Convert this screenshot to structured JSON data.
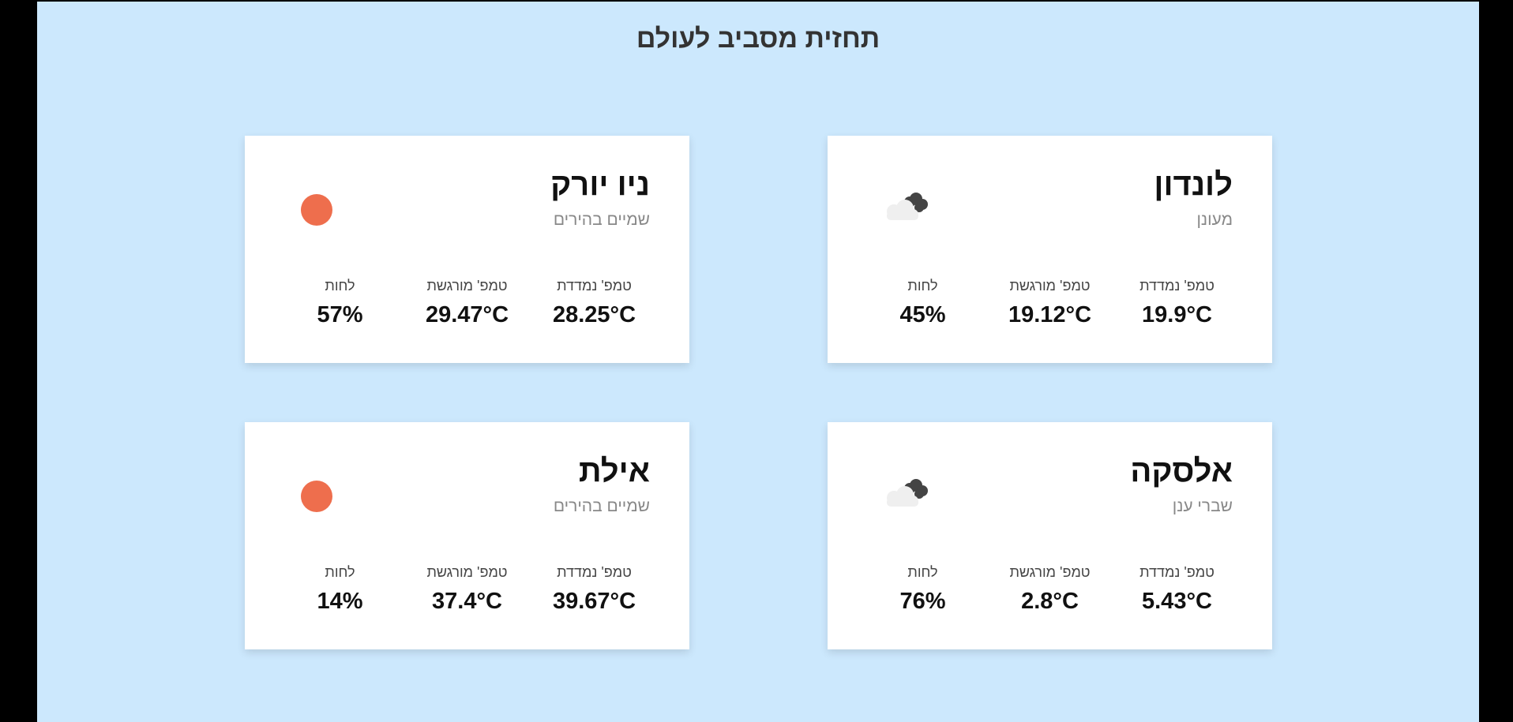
{
  "page": {
    "title": "תחזית מסביב לעולם"
  },
  "labels": {
    "temp": "טמפ' נמדדת",
    "feels_like": "טמפ' מורגשת",
    "humidity": "לחות"
  },
  "colors": {
    "background": "#cce8fd",
    "sun": "#ee6e4d",
    "cloud_dark": "#444444",
    "cloud_light": "#efefef"
  },
  "cards": [
    {
      "city": "לונדון",
      "description": "מעונן",
      "icon": "cloudy-icon",
      "temp": "19.9°C",
      "feels_like": "19.12°C",
      "humidity": "45%"
    },
    {
      "city": "ניו יורק",
      "description": "שמיים בהירים",
      "icon": "sun-icon",
      "temp": "28.25°C",
      "feels_like": "29.47°C",
      "humidity": "57%"
    },
    {
      "city": "אלסקה",
      "description": "שברי ענן",
      "icon": "cloudy-icon",
      "temp": "5.43°C",
      "feels_like": "2.8°C",
      "humidity": "76%"
    },
    {
      "city": "אילת",
      "description": "שמיים בהירים",
      "icon": "sun-icon",
      "temp": "39.67°C",
      "feels_like": "37.4°C",
      "humidity": "14%"
    }
  ]
}
